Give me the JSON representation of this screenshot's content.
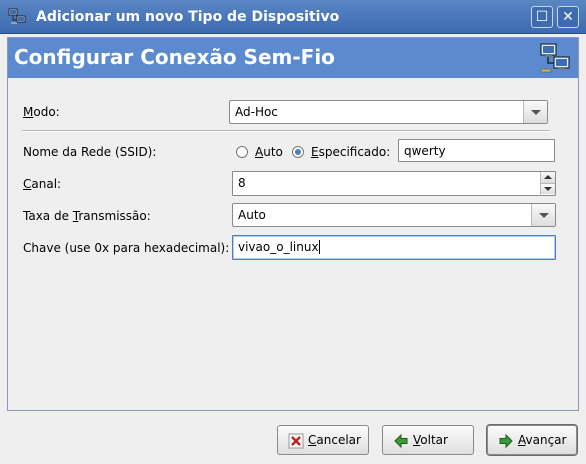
{
  "window": {
    "title": "Adicionar um novo Tipo de Dispositivo",
    "maximize_symbol": "☐",
    "close_symbol": "✕",
    "icon": "network-device-icon"
  },
  "banner": {
    "heading": "Configurar Conexão Sem-Fio",
    "icon": "network-computers-icon",
    "color": "#5b8ace"
  },
  "form": {
    "mode": {
      "label_pre": "",
      "label_acc": "M",
      "label_post": "odo:",
      "value": "Ad-Hoc"
    },
    "ssid": {
      "label": "Nome da Rede (SSID):",
      "opt_auto_acc": "A",
      "opt_auto_rest": "uto",
      "opt_spec_acc": "E",
      "opt_spec_rest": "specificado:",
      "selected": "Especificado",
      "value": "qwerty"
    },
    "channel": {
      "label_acc": "C",
      "label_post": "anal:",
      "value": "8"
    },
    "rate": {
      "label_pre": "Taxa de ",
      "label_acc": "T",
      "label_post": "ransmissão:",
      "value": "Auto"
    },
    "key": {
      "label": "Chave (use 0x para hexadecimal):",
      "value": "vivao_o_linux"
    }
  },
  "buttons": {
    "cancel": {
      "acc": "C",
      "rest": "ancelar",
      "icon": "cancel-x-icon"
    },
    "back": {
      "acc": "V",
      "rest": "oltar",
      "icon": "arrow-left-icon"
    },
    "forward": {
      "acc": "A",
      "rest": "vançar",
      "icon": "arrow-right-icon"
    }
  },
  "colors": {
    "titlebar": "#3d6bb0",
    "accent": "#4a7fc0"
  }
}
